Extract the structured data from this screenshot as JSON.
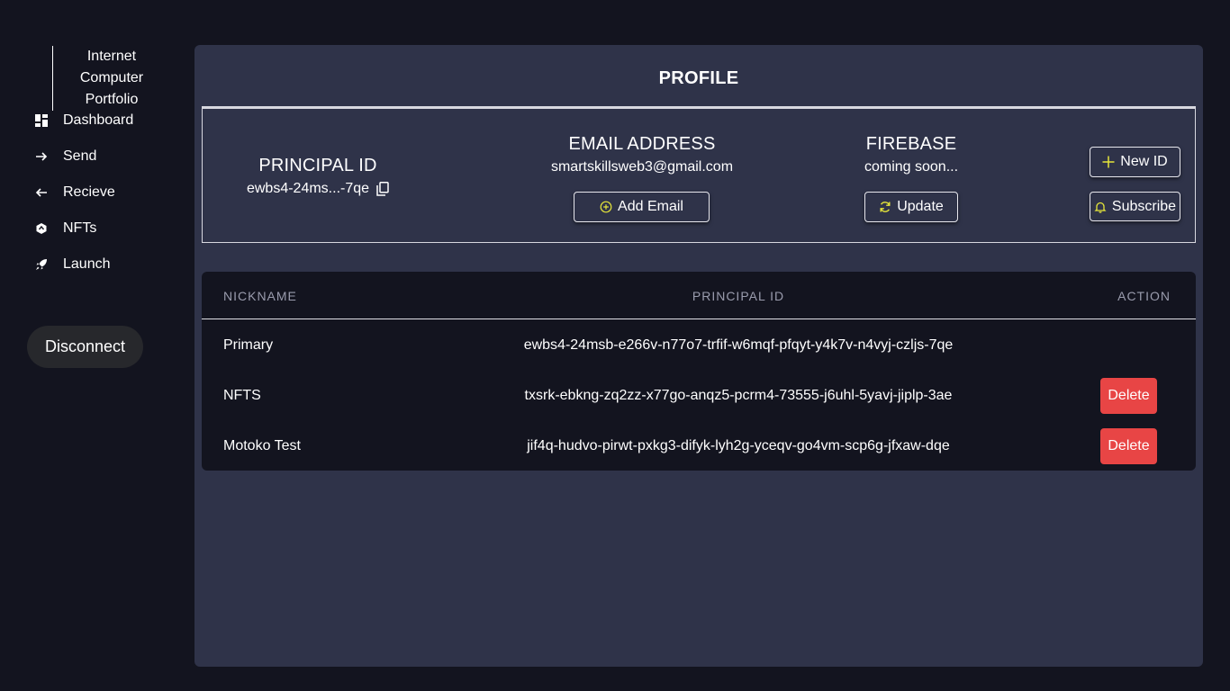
{
  "sidebar": {
    "brand": "Internet Computer Portfolio",
    "items": [
      {
        "label": "Dashboard",
        "icon": "dashboard-icon"
      },
      {
        "label": "Send",
        "icon": "arrow-right-icon"
      },
      {
        "label": "Recieve",
        "icon": "arrow-left-icon"
      },
      {
        "label": "NFTs",
        "icon": "nft-icon"
      },
      {
        "label": "Launch",
        "icon": "rocket-icon"
      }
    ],
    "disconnect_label": "Disconnect"
  },
  "main": {
    "title": "PROFILE",
    "profile": {
      "principal_heading": "PRINCIPAL ID",
      "principal_value": "ewbs4-24ms...-7qe",
      "email_heading": "EMAIL ADDRESS",
      "email_value": "smartskillsweb3@gmail.com",
      "add_email_label": "Add Email",
      "firebase_heading": "FIREBASE",
      "firebase_value": "coming soon...",
      "update_label": "Update",
      "new_id_label": "New ID",
      "subscribe_label": "Subscribe"
    },
    "table": {
      "headers": [
        "NICKNAME",
        "PRINCIPAL ID",
        "ACTION"
      ],
      "rows": [
        {
          "nickname": "Primary",
          "principal": "ewbs4-24msb-e266v-n77o7-trfif-w6mqf-pfqyt-y4k7v-n4vyj-czljs-7qe",
          "action": ""
        },
        {
          "nickname": "NFTS",
          "principal": "txsrk-ebkng-zq2zz-x77go-anqz5-pcrm4-73555-j6uhl-5yavj-jiplp-3ae",
          "action": "Delete"
        },
        {
          "nickname": "Motoko Test",
          "principal": "jif4q-hudvo-pirwt-pxkg3-difyk-lyh2g-yceqv-go4vm-scp6g-jfxaw-dqe",
          "action": "Delete"
        }
      ]
    }
  },
  "colors": {
    "background": "#13141f",
    "panel": "#2f3349",
    "accent_icon": "#e6e63a",
    "delete": "#e84545"
  }
}
